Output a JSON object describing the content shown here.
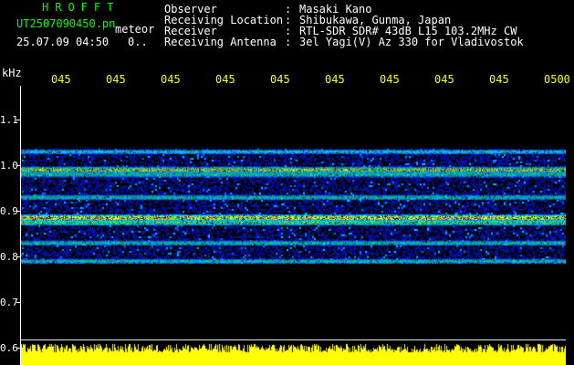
{
  "header": {
    "brand": "HROFFT",
    "filename": "UT2507090450.pn",
    "filename_suffix": "meteor",
    "datetime": "25.07.09 04:50",
    "datetime_extra": "0..",
    "fields": [
      {
        "label": "Observer",
        "colon": ":",
        "value": "Masaki Kano"
      },
      {
        "label": "Receiving Location",
        "colon": ":",
        "value": "Shibukawa, Gunma, Japan"
      },
      {
        "label": "Receiver",
        "colon": ":",
        "value": "RTL-SDR SDR# 43dB L15 103.2MHz CW"
      },
      {
        "label": "Receiving Antenna",
        "colon": ":",
        "value": "3el Yagi(V) Az 330 for Vladivostok"
      }
    ]
  },
  "chart_data": {
    "type": "heatmap",
    "ylabel": "kHz",
    "yticks": [
      "1.1",
      "1.0",
      "0.9",
      "0.8",
      "0.7",
      "0.6"
    ],
    "ylim": [
      0.6,
      1.15
    ],
    "xticks": [
      "045",
      "045",
      "045",
      "045",
      "045",
      "045",
      "045",
      "045",
      "045",
      "0500"
    ],
    "bands_khz": [
      {
        "freq": 1.03,
        "strength": 0.45
      },
      {
        "freq": 0.99,
        "strength": 0.9
      },
      {
        "freq": 0.98,
        "strength": 0.6
      },
      {
        "freq": 0.93,
        "strength": 0.55
      },
      {
        "freq": 0.885,
        "strength": 1.0
      },
      {
        "freq": 0.875,
        "strength": 0.7
      },
      {
        "freq": 0.83,
        "strength": 0.55
      },
      {
        "freq": 0.79,
        "strength": 0.5
      }
    ],
    "noise_region_khz": [
      0.785,
      1.035
    ],
    "colors": {
      "background": "#000000",
      "noise": "#0a1a9a",
      "band": "#00c8ff",
      "hot": "#ff3040",
      "noise_bar": "#ffff00"
    }
  }
}
